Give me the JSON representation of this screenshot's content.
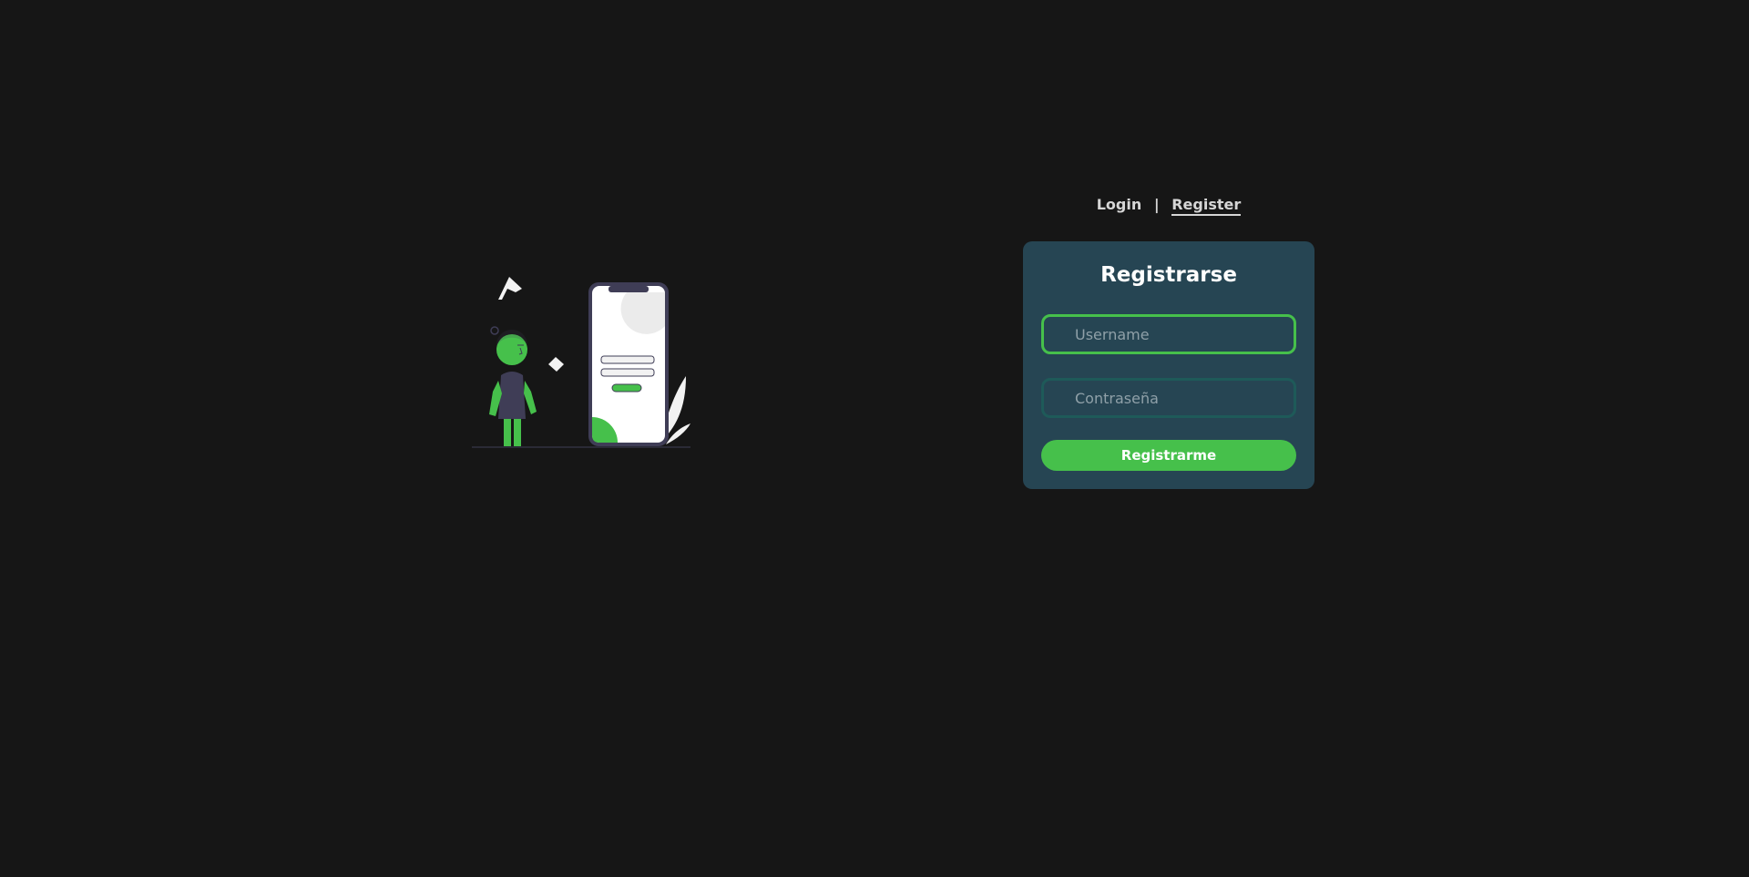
{
  "nav": {
    "login_label": "Login",
    "separator": "|",
    "register_label": "Register"
  },
  "form": {
    "title": "Registrarse",
    "username_placeholder": "Username",
    "password_placeholder": "Contraseña",
    "submit_label": "Registrarme"
  },
  "colors": {
    "background": "#161616",
    "card": "#264553",
    "accent": "#46c04b",
    "inactive_border": "#1e5a59",
    "text_light": "#d6d6d6"
  },
  "illustration": {
    "icon": "person-with-phone-login-illustration"
  }
}
